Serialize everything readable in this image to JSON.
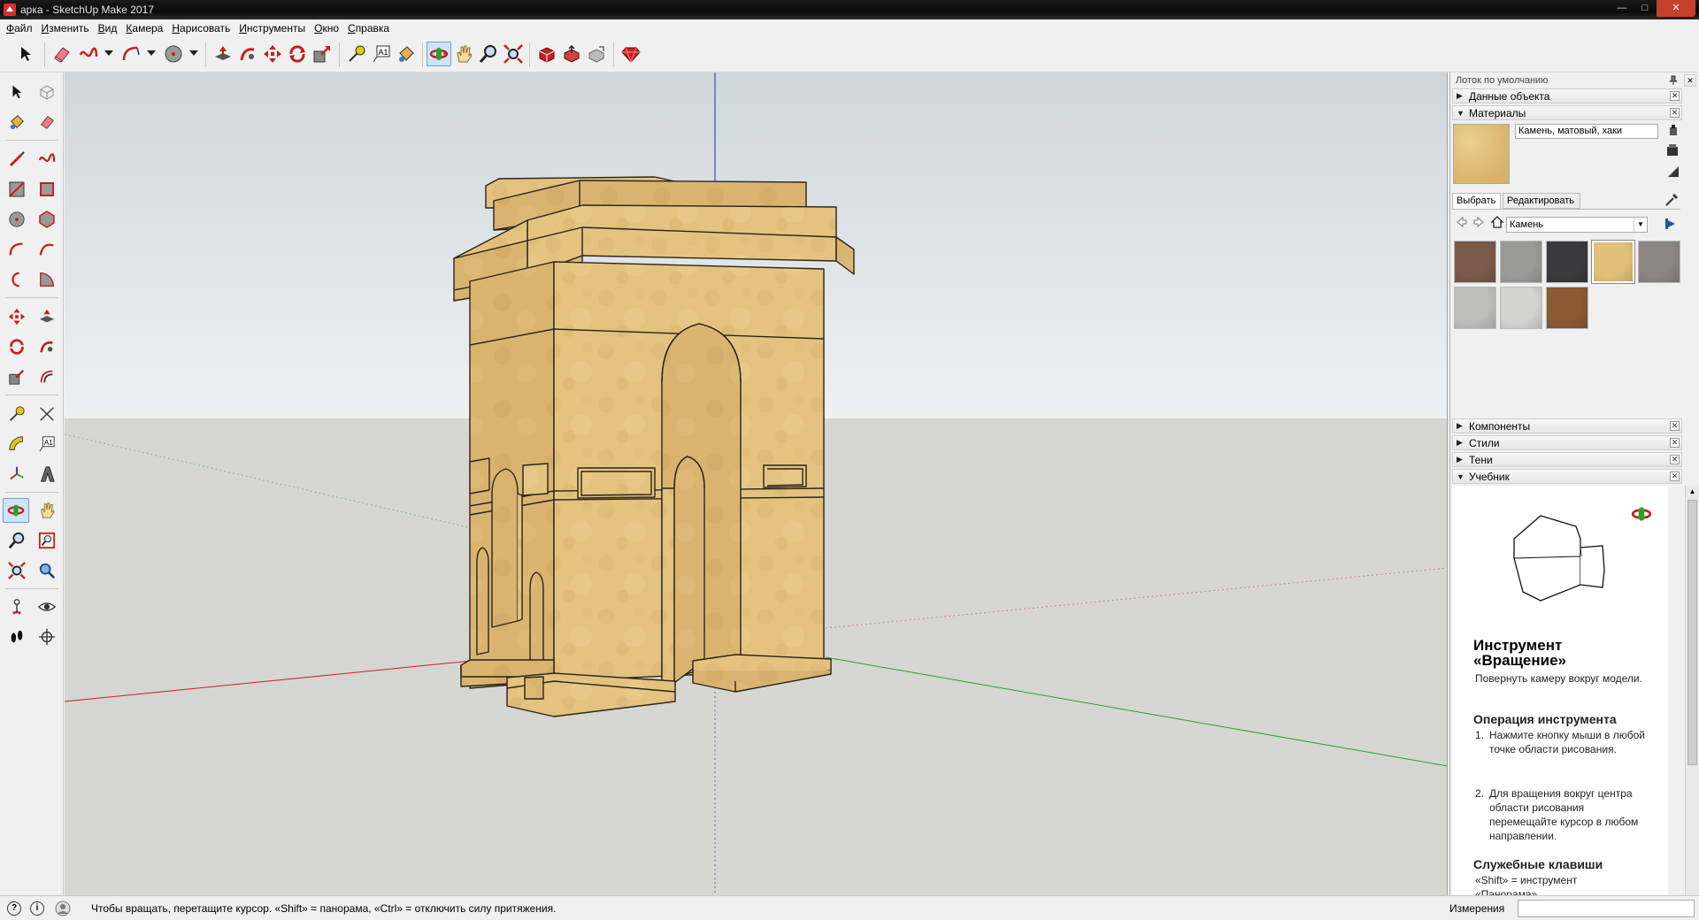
{
  "window": {
    "title": "арка - SketchUp Make 2017",
    "controls": [
      "minimize",
      "maximize",
      "close"
    ]
  },
  "menu": [
    "Файл",
    "Изменить",
    "Вид",
    "Камера",
    "Нарисовать",
    "Инструменты",
    "Окно",
    "Справка"
  ],
  "toolbar": {
    "tools": [
      "select",
      "eraser",
      "freehand",
      "arc",
      "circle",
      "push-pull",
      "follow-me",
      "move",
      "rotate",
      "scale",
      "tape-measure",
      "text",
      "paint-bucket",
      "orbit",
      "pan",
      "zoom",
      "zoom-extents",
      "warehouse",
      "share-model",
      "extension-warehouse",
      "ruby"
    ],
    "active_tool": "orbit"
  },
  "left_toolbar": {
    "active_tool": "orbit",
    "text_tool_label": "A1"
  },
  "viewport": {
    "sky_color": "#dfe6ea",
    "ground_color": "#d6d6d3",
    "model_color": "#e3c27f",
    "axis_colors": {
      "red": "#cc2020",
      "green": "#2aa02a",
      "blue": "#2030c0"
    }
  },
  "tray": {
    "title": "Лоток по умолчанию",
    "panels": {
      "entity_info": "Данные объекта",
      "materials": "Материалы",
      "components": "Компоненты",
      "styles": "Стили",
      "shadows": "Тени",
      "instructor": "Учебник"
    },
    "materials": {
      "current_name": "Камень, матовый, хаки",
      "tab_select": "Выбрать",
      "tab_edit": "Редактировать",
      "library": "Камень",
      "swatches": [
        "#7a5a4a",
        "#9a9a98",
        "#3a3a3c",
        "#e2c07a",
        "#8c8582",
        "#bdbdbb",
        "#d4d4d2",
        "#8a5a32"
      ]
    },
    "instructor": {
      "title": "Инструмент «Вращение»",
      "description": "Повернуть камеру вокруг модели.",
      "op_heading": "Операция инструмента",
      "steps": [
        "Нажмите кнопку мыши в любой точке области рисования.",
        "Для вращения вокруг центра области рисования перемещайте курсор в любом направлении."
      ],
      "keys_heading": "Служебные клавиши",
      "keys_text": "«Shift» = инструмент «Панорама»"
    }
  },
  "status": {
    "hint": "Чтобы вращать, перетащите курсор. «Shift» = панорама, «Ctrl» = отключить силу притяжения.",
    "measurements_label": "Измерения",
    "measurements_value": ""
  }
}
